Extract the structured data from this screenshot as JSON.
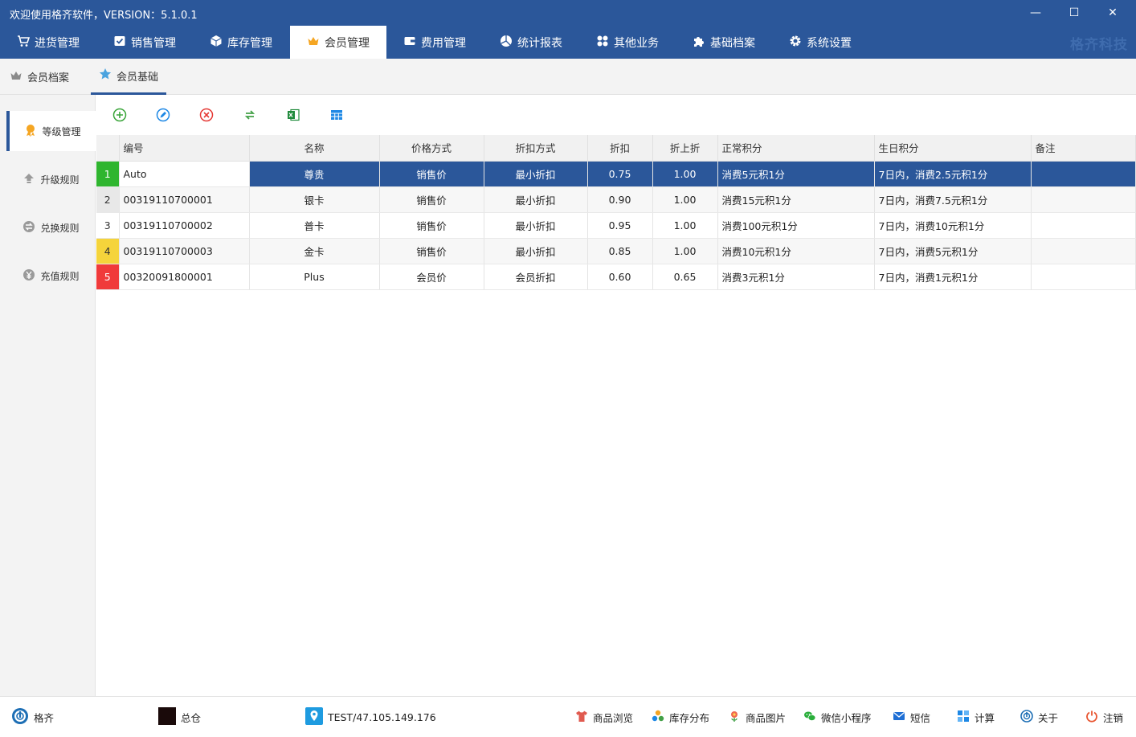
{
  "window": {
    "title": "欢迎使用格齐软件，VERSION：5.1.0.1",
    "controls": {
      "minimize": "—",
      "maximize": "☐",
      "close": "✕"
    }
  },
  "nav": {
    "tabs": [
      {
        "label": "进货管理",
        "icon": "cart-icon"
      },
      {
        "label": "销售管理",
        "icon": "check-box-icon"
      },
      {
        "label": "库存管理",
        "icon": "cube-icon"
      },
      {
        "label": "会员管理",
        "icon": "crown-icon",
        "active": true
      },
      {
        "label": "费用管理",
        "icon": "wallet-icon"
      },
      {
        "label": "统计报表",
        "icon": "pie-chart-icon"
      },
      {
        "label": "其他业务",
        "icon": "grid-icon"
      },
      {
        "label": "基础档案",
        "icon": "puzzle-icon"
      },
      {
        "label": "系统设置",
        "icon": "gear-icon"
      }
    ],
    "brand": "格齐科技"
  },
  "subtabs": [
    {
      "label": "会员档案",
      "icon": "crown-icon"
    },
    {
      "label": "会员基础",
      "icon": "star-icon",
      "active": true
    }
  ],
  "sidenav": [
    {
      "label": "等级管理",
      "icon": "medal-icon",
      "active": true
    },
    {
      "label": "升级规则",
      "icon": "upgrade-icon"
    },
    {
      "label": "兑换规则",
      "icon": "exchange-icon"
    },
    {
      "label": "充值规则",
      "icon": "yen-icon"
    }
  ],
  "toolbar": [
    {
      "name": "add-icon",
      "color": "#3aa53a"
    },
    {
      "name": "edit-icon",
      "color": "#1e88e5"
    },
    {
      "name": "delete-icon",
      "color": "#e53935"
    },
    {
      "name": "refresh-icon",
      "color": "#43a047"
    },
    {
      "name": "excel-icon",
      "color": "#1f8a3b"
    },
    {
      "name": "table-icon",
      "color": "#1e88e5"
    }
  ],
  "table": {
    "headers": [
      "编号",
      "名称",
      "价格方式",
      "折扣方式",
      "折扣",
      "折上折",
      "正常积分",
      "生日积分",
      "备注"
    ],
    "rows": [
      {
        "no": "1",
        "code": "Auto",
        "name": "尊贵",
        "price_mode": "销售价",
        "discount_mode": "最小折扣",
        "discount": "0.75",
        "extra_discount": "1.00",
        "normal_points": "消费5元积1分",
        "birthday_points": "7日内，消费2.5元积1分",
        "remark": "",
        "badge": "#2fb52f",
        "badge_text": "#ffffff"
      },
      {
        "no": "2",
        "code": "00319110700001",
        "name": "银卡",
        "price_mode": "销售价",
        "discount_mode": "最小折扣",
        "discount": "0.90",
        "extra_discount": "1.00",
        "normal_points": "消费15元积1分",
        "birthday_points": "7日内，消费7.5元积1分",
        "remark": "",
        "badge": "#e8e8e8",
        "badge_text": "#333333"
      },
      {
        "no": "3",
        "code": "00319110700002",
        "name": "普卡",
        "price_mode": "销售价",
        "discount_mode": "最小折扣",
        "discount": "0.95",
        "extra_discount": "1.00",
        "normal_points": "消费100元积1分",
        "birthday_points": "7日内，消费10元积1分",
        "remark": "",
        "badge": "#ffffff",
        "badge_text": "#333333"
      },
      {
        "no": "4",
        "code": "00319110700003",
        "name": "金卡",
        "price_mode": "销售价",
        "discount_mode": "最小折扣",
        "discount": "0.85",
        "extra_discount": "1.00",
        "normal_points": "消费10元积1分",
        "birthday_points": "7日内，消费5元积1分",
        "remark": "",
        "badge": "#f5d43b",
        "badge_text": "#333333"
      },
      {
        "no": "5",
        "code": "00320091800001",
        "name": "Plus",
        "price_mode": "会员价",
        "discount_mode": "会员折扣",
        "discount": "0.60",
        "extra_discount": "0.65",
        "normal_points": "消费3元积1分",
        "birthday_points": "7日内，消费1元积1分",
        "remark": "",
        "badge": "#f03a3a",
        "badge_text": "#ffffff"
      }
    ]
  },
  "statusbar": {
    "user": "格齐",
    "warehouse": "总仓",
    "server": "TEST/47.105.149.176",
    "links": [
      {
        "label": "商品浏览",
        "icon": "shirt-icon"
      },
      {
        "label": "库存分布",
        "icon": "dots-icon"
      },
      {
        "label": "商品图片",
        "icon": "flower-icon"
      },
      {
        "label": "微信小程序",
        "icon": "wechat-icon"
      },
      {
        "label": "短信",
        "icon": "mail-icon"
      },
      {
        "label": "计算",
        "icon": "calculator-icon"
      },
      {
        "label": "关于",
        "icon": "about-icon"
      },
      {
        "label": "注销",
        "icon": "power-icon"
      }
    ]
  }
}
